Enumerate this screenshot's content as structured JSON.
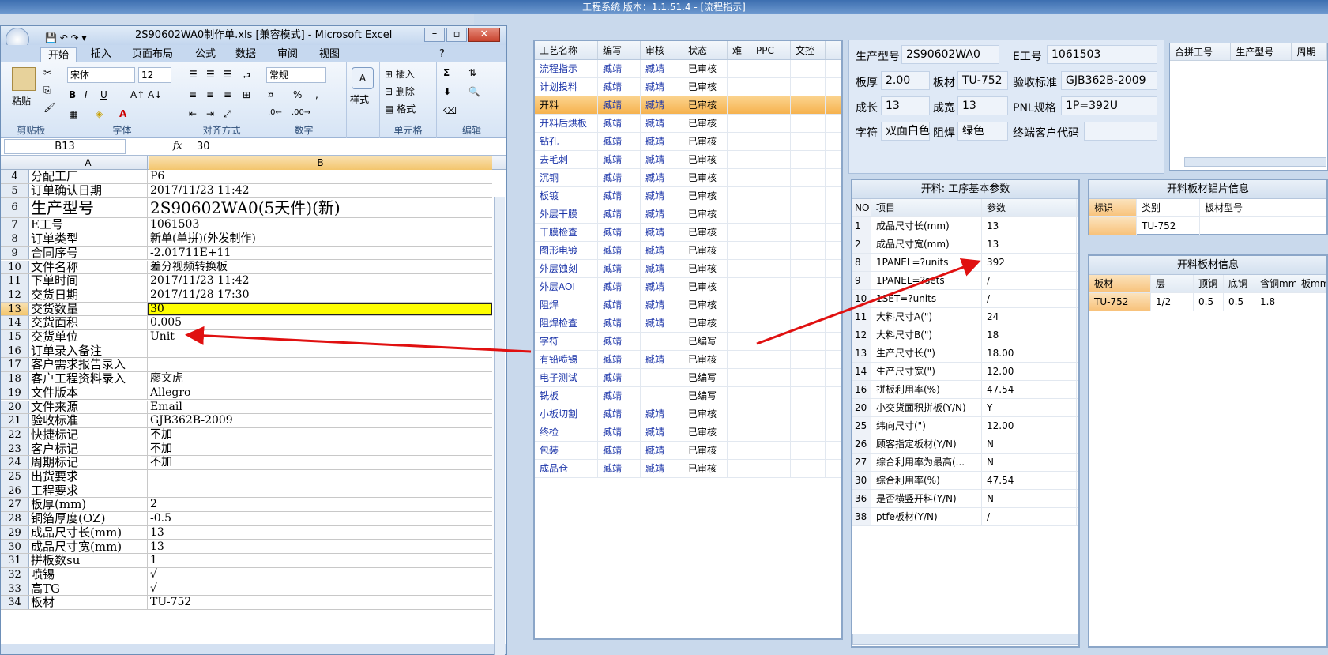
{
  "app": {
    "title": "工程系统  版本：1.1.51.4 - [流程指示]"
  },
  "excel": {
    "title": "2S90602WA0制作单.xls  [兼容模式] - Microsoft Excel",
    "tabs": [
      "开始",
      "插入",
      "页面布局",
      "公式",
      "数据",
      "审阅",
      "视图"
    ],
    "groups": {
      "clipboard": "剪贴板",
      "font": "字体",
      "align": "对齐方式",
      "number": "数字",
      "cells": "单元格",
      "edit": "编辑"
    },
    "paste": "粘贴",
    "font_name": "宋体",
    "font_size": "12",
    "number_format": "常规",
    "style": "样式",
    "insert": "插入",
    "delete": "删除",
    "format": "格式",
    "name_box": "B13",
    "formula": "30",
    "col_a": "A",
    "col_b": "B",
    "rows": [
      {
        "n": "4",
        "a": "分配工厂",
        "b": "P6"
      },
      {
        "n": "5",
        "a": "订单确认日期",
        "b": "2017/11/23 11:42"
      },
      {
        "n": "6",
        "a": "生产型号",
        "b": "2S90602WA0(5天件)(新)"
      },
      {
        "n": "7",
        "a": "E工号",
        "b": "1061503"
      },
      {
        "n": "8",
        "a": "订单类型",
        "b": "新单(单拼)(外发制作)"
      },
      {
        "n": "9",
        "a": "合同序号",
        "b": "-2.01711E+11"
      },
      {
        "n": "10",
        "a": "文件名称",
        "b": "差分视频转换板"
      },
      {
        "n": "11",
        "a": "下单时间",
        "b": "2017/11/23 11:42"
      },
      {
        "n": "12",
        "a": "交货日期",
        "b": "2017/11/28 17:30"
      },
      {
        "n": "13",
        "a": "交货数量",
        "b": "30"
      },
      {
        "n": "14",
        "a": "交货面积",
        "b": "0.005"
      },
      {
        "n": "15",
        "a": "交货单位",
        "b": "Unit"
      },
      {
        "n": "16",
        "a": "订单录入备注",
        "b": ""
      },
      {
        "n": "17",
        "a": "客户需求报告录入",
        "b": ""
      },
      {
        "n": "18",
        "a": "客户工程资料录入",
        "b": "廖文虎"
      },
      {
        "n": "19",
        "a": "文件版本",
        "b": "Allegro"
      },
      {
        "n": "20",
        "a": "文件来源",
        "b": "Email"
      },
      {
        "n": "21",
        "a": "验收标准",
        "b": "GJB362B-2009"
      },
      {
        "n": "22",
        "a": "快捷标记",
        "b": "不加"
      },
      {
        "n": "23",
        "a": "客户标记",
        "b": "不加"
      },
      {
        "n": "24",
        "a": "周期标记",
        "b": "不加"
      },
      {
        "n": "25",
        "a": "出货要求",
        "b": ""
      },
      {
        "n": "26",
        "a": "工程要求",
        "b": ""
      },
      {
        "n": "27",
        "a": "板厚(mm)",
        "b": "2"
      },
      {
        "n": "28",
        "a": "铜箔厚度(OZ)",
        "b": "-0.5"
      },
      {
        "n": "29",
        "a": "成品尺寸长(mm)",
        "b": "13"
      },
      {
        "n": "30",
        "a": "成品尺寸宽(mm)",
        "b": "13"
      },
      {
        "n": "31",
        "a": "拼板数su",
        "b": "1"
      },
      {
        "n": "32",
        "a": "喷锡",
        "b": "√"
      },
      {
        "n": "33",
        "a": "高TG",
        "b": "√"
      },
      {
        "n": "34",
        "a": "板材",
        "b": "TU-752"
      }
    ]
  },
  "process": {
    "headers": [
      "工艺名称",
      "编写",
      "审核",
      "状态",
      "难",
      "PPC",
      "文控"
    ],
    "rows": [
      {
        "name": "流程指示",
        "w": "臧靖",
        "r": "臧靖",
        "s": "已审核"
      },
      {
        "name": "计划投料",
        "w": "臧靖",
        "r": "臧靖",
        "s": "已审核"
      },
      {
        "name": "开料",
        "w": "臧靖",
        "r": "臧靖",
        "s": "已审核"
      },
      {
        "name": "开料后烘板",
        "w": "臧靖",
        "r": "臧靖",
        "s": "已审核"
      },
      {
        "name": "钻孔",
        "w": "臧靖",
        "r": "臧靖",
        "s": "已审核"
      },
      {
        "name": "去毛刺",
        "w": "臧靖",
        "r": "臧靖",
        "s": "已审核"
      },
      {
        "name": "沉铜",
        "w": "臧靖",
        "r": "臧靖",
        "s": "已审核"
      },
      {
        "name": "板镀",
        "w": "臧靖",
        "r": "臧靖",
        "s": "已审核"
      },
      {
        "name": "外层干膜",
        "w": "臧靖",
        "r": "臧靖",
        "s": "已审核"
      },
      {
        "name": "干膜检查",
        "w": "臧靖",
        "r": "臧靖",
        "s": "已审核"
      },
      {
        "name": "图形电镀",
        "w": "臧靖",
        "r": "臧靖",
        "s": "已审核"
      },
      {
        "name": "外层蚀刻",
        "w": "臧靖",
        "r": "臧靖",
        "s": "已审核"
      },
      {
        "name": "外层AOI",
        "w": "臧靖",
        "r": "臧靖",
        "s": "已审核"
      },
      {
        "name": "阻焊",
        "w": "臧靖",
        "r": "臧靖",
        "s": "已审核"
      },
      {
        "name": "阻焊检查",
        "w": "臧靖",
        "r": "臧靖",
        "s": "已审核"
      },
      {
        "name": "字符",
        "w": "臧靖",
        "r": "",
        "s": "已编写"
      },
      {
        "name": "有铅喷锡",
        "w": "臧靖",
        "r": "臧靖",
        "s": "已审核"
      },
      {
        "name": "电子测试",
        "w": "臧靖",
        "r": "",
        "s": "已编写"
      },
      {
        "name": "铣板",
        "w": "臧靖",
        "r": "",
        "s": "已编写"
      },
      {
        "name": "小板切割",
        "w": "臧靖",
        "r": "臧靖",
        "s": "已审核"
      },
      {
        "name": "终检",
        "w": "臧靖",
        "r": "臧靖",
        "s": "已审核"
      },
      {
        "name": "包装",
        "w": "臧靖",
        "r": "臧靖",
        "s": "已审核"
      },
      {
        "name": "成品仓",
        "w": "臧靖",
        "r": "臧靖",
        "s": "已审核"
      }
    ]
  },
  "info": {
    "model_label": "生产型号",
    "model": "2S90602WA0",
    "eno_label": "E工号",
    "eno": "1061503",
    "thick_label": "板厚",
    "thick": "2.00",
    "mat_label": "板材",
    "mat": "TU-752",
    "std_label": "验收标准",
    "std": "GJB362B-2009",
    "len_label": "成长",
    "len": "13",
    "wid_label": "成宽",
    "wid": "13",
    "pnl_label": "PNL规格",
    "pnl": "1P=392U",
    "char_label": "字符",
    "char": "双面白色",
    "mask_label": "阻焊",
    "mask": "绿色",
    "cust_label": "终端客户代码",
    "cust": ""
  },
  "combined": {
    "headers": [
      "合拼工号",
      "生产型号",
      "周期"
    ]
  },
  "params": {
    "title": "开料: 工序基本参数",
    "headers": [
      "NO",
      "项目",
      "参数"
    ],
    "rows": [
      {
        "no": "1",
        "item": "成品尺寸长(mm)",
        "val": "13"
      },
      {
        "no": "2",
        "item": "成品尺寸宽(mm)",
        "val": "13"
      },
      {
        "no": "8",
        "item": "1PANEL=?units",
        "val": "392"
      },
      {
        "no": "9",
        "item": "1PANEL=?sets",
        "val": "/"
      },
      {
        "no": "10",
        "item": "1SET=?units",
        "val": "/"
      },
      {
        "no": "11",
        "item": "大料尺寸A(\")",
        "val": "24"
      },
      {
        "no": "12",
        "item": "大料尺寸B(\")",
        "val": "18"
      },
      {
        "no": "13",
        "item": "生产尺寸长(\")",
        "val": "18.00"
      },
      {
        "no": "14",
        "item": "生产尺寸宽(\")",
        "val": "12.00"
      },
      {
        "no": "16",
        "item": "拼板利用率(%)",
        "val": "47.54"
      },
      {
        "no": "20",
        "item": "小交货面积拼板(Y/N)",
        "val": "Y"
      },
      {
        "no": "25",
        "item": "纬向尺寸(\")",
        "val": "12.00"
      },
      {
        "no": "26",
        "item": "顾客指定板材(Y/N)",
        "val": "N"
      },
      {
        "no": "27",
        "item": "综合利用率为最高(...",
        "val": "N"
      },
      {
        "no": "30",
        "item": "综合利用率(%)",
        "val": "47.54"
      },
      {
        "no": "36",
        "item": "是否横竖开料(Y/N)",
        "val": "N"
      },
      {
        "no": "38",
        "item": "ptfe板材(Y/N)",
        "val": "/"
      }
    ]
  },
  "board_photo": {
    "title": "开料板材铝片信息",
    "headers": [
      "标识",
      "类别",
      "板材型号"
    ],
    "row": [
      "",
      "TU-752",
      ""
    ]
  },
  "board_info": {
    "title": "开料板材信息",
    "headers": [
      "板材",
      "层",
      "顶铜",
      "底铜",
      "含铜mm",
      "板mm"
    ],
    "row": [
      "TU-752",
      "1/2",
      "0.5",
      "0.5",
      "1.8",
      ""
    ]
  }
}
